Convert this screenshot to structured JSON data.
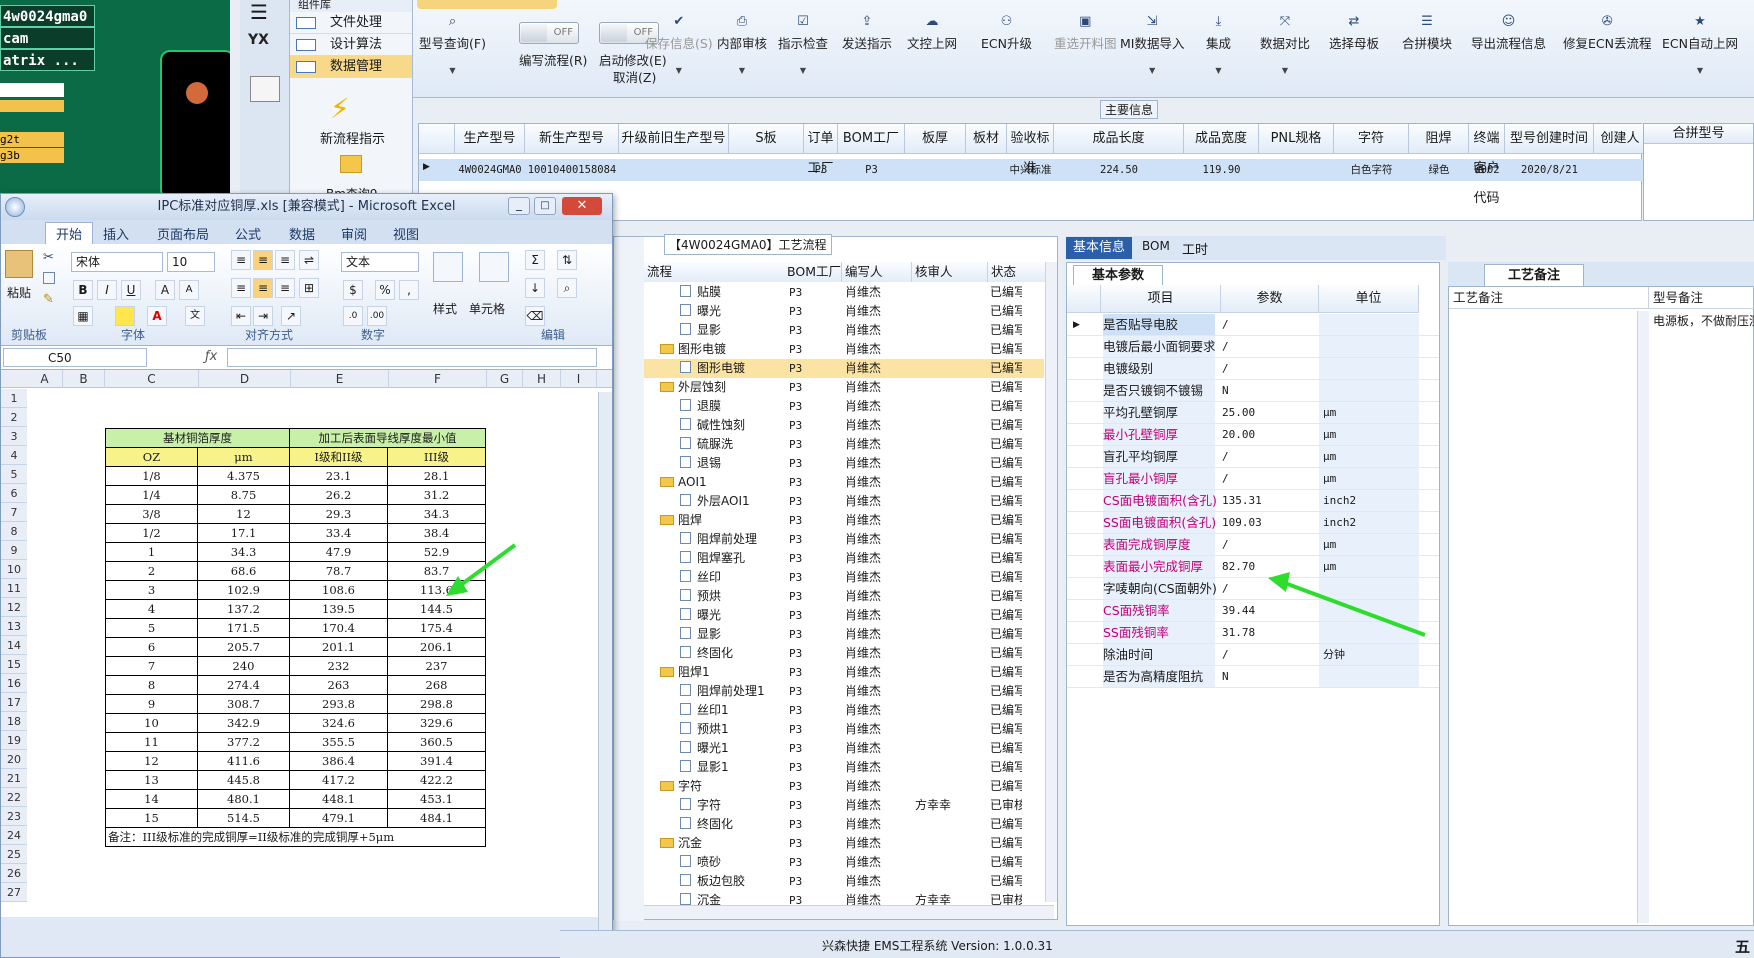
{
  "top_left": {
    "rows": [
      "4w0024gma0",
      "cam",
      "atrix ..."
    ],
    "yellow": [
      "g2t",
      "g3b"
    ]
  },
  "side_strip": {
    "logo": "YX"
  },
  "groups": {
    "title": "组件库",
    "items": [
      {
        "label": "文件处理",
        "selected": false
      },
      {
        "label": "设计算法",
        "selected": false
      },
      {
        "label": "数据管理",
        "selected": true
      }
    ],
    "new_flow": "新流程指示",
    "cut_label": "Bm查询9"
  },
  "toolbar": {
    "buttons": [
      {
        "label": "型号查询(F)",
        "icon": "search-icon",
        "disabled": false,
        "dropdown": true
      },
      {
        "label": "编写流程(R)",
        "icon": "toggle",
        "disabled": false,
        "dropdown": false
      },
      {
        "label": "启动修改(E)",
        "sub": "取消(Z)",
        "icon": "toggle",
        "disabled": false,
        "dropdown": false
      },
      {
        "label": "保存信息(S)",
        "icon": "check-icon",
        "disabled": true,
        "dropdown": true
      },
      {
        "label": "内部审核",
        "icon": "printer-icon",
        "disabled": false,
        "dropdown": true
      },
      {
        "label": "指示检查",
        "icon": "checkbox-icon",
        "disabled": false,
        "dropdown": true
      },
      {
        "label": "发送指示",
        "icon": "upload-icon",
        "disabled": false,
        "dropdown": false
      },
      {
        "label": "文控上网",
        "icon": "cloud-upload-icon",
        "disabled": false,
        "dropdown": false
      },
      {
        "label": "ECN升级",
        "icon": "people-icon",
        "disabled": false,
        "dropdown": false
      },
      {
        "label": "重选开料图",
        "icon": "image-icon",
        "disabled": true,
        "dropdown": false
      },
      {
        "label": "MI数据导入",
        "icon": "import-icon",
        "disabled": false,
        "dropdown": true
      },
      {
        "label": "集成",
        "icon": "download-icon",
        "disabled": false,
        "dropdown": true
      },
      {
        "label": "数据对比",
        "icon": "compare-icon",
        "disabled": false,
        "dropdown": true
      },
      {
        "label": "选择母板",
        "icon": "shuffle-icon",
        "disabled": false,
        "dropdown": false
      },
      {
        "label": "合拼模块",
        "icon": "list-icon",
        "disabled": false,
        "dropdown": false
      },
      {
        "label": "导出流程信息",
        "icon": "smiley-icon",
        "disabled": false,
        "dropdown": false
      },
      {
        "label": "修复ECN丢流程",
        "icon": "wrench-icon",
        "disabled": false,
        "dropdown": false
      },
      {
        "label": "ECN自动上网",
        "icon": "star-icon",
        "disabled": false,
        "dropdown": true
      }
    ],
    "toggle_off": "OFF"
  },
  "main_info": {
    "title": "主要信息",
    "columns": [
      "生产型号",
      "新生产型号",
      "升级前旧生产型号",
      "S板",
      "订单工厂",
      "BOM工厂",
      "板厚",
      "板材",
      "验收标准",
      "成品长度",
      "成品宽度",
      "PNL规格",
      "字符",
      "阻焊",
      "终端客户代码",
      "型号创建时间",
      "创建人"
    ],
    "row": [
      "4W0024GMA0",
      "10010400158084",
      "",
      "",
      "P3",
      "P3",
      "",
      "",
      "中兴标准",
      "224.50",
      "119.90",
      "",
      "白色字符",
      "绿色",
      "W002",
      "2020/8/21",
      ""
    ],
    "pin_header": "合拼型号"
  },
  "excel": {
    "title": "IPC标准对应铜厚.xls [兼容模式] - Microsoft Excel",
    "tabs": [
      "开始",
      "插入",
      "页面布局",
      "公式",
      "数据",
      "审阅",
      "视图"
    ],
    "font_name": "宋体",
    "font_size": "10",
    "number_format": "文本",
    "groups": [
      "剪贴板",
      "字体",
      "对齐方式",
      "数字",
      "样式",
      "单元格",
      "编辑"
    ],
    "paste": "粘贴",
    "style_label": "样式",
    "cells_label": "单元格",
    "name_box": "C50",
    "columns": [
      "A",
      "B",
      "C",
      "D",
      "E",
      "F",
      "G",
      "H",
      "I"
    ],
    "rows": [
      "1",
      "2",
      "3",
      "4",
      "5",
      "6",
      "7",
      "8",
      "9",
      "10",
      "11",
      "12",
      "13",
      "14",
      "15",
      "16",
      "17",
      "18",
      "19",
      "20",
      "21",
      "22",
      "23",
      "24",
      "25",
      "26",
      "27"
    ],
    "table_head1": [
      "基材铜箔厚度",
      "加工后表面导线厚度最小值"
    ],
    "table_head2": [
      "OZ",
      "μm",
      "I级和II级",
      "III级"
    ],
    "table_rows": [
      [
        "1/8",
        "4.375",
        "23.1",
        "28.1"
      ],
      [
        "1/4",
        "8.75",
        "26.2",
        "31.2"
      ],
      [
        "3/8",
        "12",
        "29.3",
        "34.3"
      ],
      [
        "1/2",
        "17.1",
        "33.4",
        "38.4"
      ],
      [
        "1",
        "34.3",
        "47.9",
        "52.9"
      ],
      [
        "2",
        "68.6",
        "78.7",
        "83.7"
      ],
      [
        "3",
        "102.9",
        "108.6",
        "113.6"
      ],
      [
        "4",
        "137.2",
        "139.5",
        "144.5"
      ],
      [
        "5",
        "171.5",
        "170.4",
        "175.4"
      ],
      [
        "6",
        "205.7",
        "201.1",
        "206.1"
      ],
      [
        "7",
        "240",
        "232",
        "237"
      ],
      [
        "8",
        "274.4",
        "263",
        "268"
      ],
      [
        "9",
        "308.7",
        "293.8",
        "298.8"
      ],
      [
        "10",
        "342.9",
        "324.6",
        "329.6"
      ],
      [
        "11",
        "377.2",
        "355.5",
        "360.5"
      ],
      [
        "12",
        "411.6",
        "386.4",
        "391.4"
      ],
      [
        "13",
        "445.8",
        "417.2",
        "422.2"
      ],
      [
        "14",
        "480.1",
        "448.1",
        "453.1"
      ],
      [
        "15",
        "514.5",
        "479.1",
        "484.1"
      ]
    ],
    "note": "备注：III级标准的完成铜厚=II级标准的完成铜厚+5μm"
  },
  "flow": {
    "title": "【4W0024GMA0】工艺流程",
    "columns": [
      "流程",
      "BOM工厂",
      "编写人",
      "核审人",
      "状态"
    ],
    "rows": [
      {
        "name": "贴膜",
        "level": 2,
        "folder": false,
        "bom": "P3",
        "author": "肖维杰",
        "reviewer": "",
        "status": "已编写"
      },
      {
        "name": "曝光",
        "level": 2,
        "folder": false,
        "bom": "P3",
        "author": "肖维杰",
        "reviewer": "",
        "status": "已编写"
      },
      {
        "name": "显影",
        "level": 2,
        "folder": false,
        "bom": "P3",
        "author": "肖维杰",
        "reviewer": "",
        "status": "已编写"
      },
      {
        "name": "图形电镀",
        "level": 1,
        "folder": true,
        "bom": "P3",
        "author": "肖维杰",
        "reviewer": "",
        "status": "已编写"
      },
      {
        "name": "图形电镀",
        "level": 2,
        "folder": false,
        "bom": "P3",
        "author": "肖维杰",
        "reviewer": "",
        "status": "已编写",
        "selected": true
      },
      {
        "name": "外层蚀刻",
        "level": 1,
        "folder": true,
        "bom": "P3",
        "author": "肖维杰",
        "reviewer": "",
        "status": "已编写"
      },
      {
        "name": "退膜",
        "level": 2,
        "folder": false,
        "bom": "P3",
        "author": "肖维杰",
        "reviewer": "",
        "status": "已编写"
      },
      {
        "name": "碱性蚀刻",
        "level": 2,
        "folder": false,
        "bom": "P3",
        "author": "肖维杰",
        "reviewer": "",
        "status": "已编写"
      },
      {
        "name": "硫脲洗",
        "level": 2,
        "folder": false,
        "bom": "P3",
        "author": "肖维杰",
        "reviewer": "",
        "status": "已编写"
      },
      {
        "name": "退锡",
        "level": 2,
        "folder": false,
        "bom": "P3",
        "author": "肖维杰",
        "reviewer": "",
        "status": "已编写"
      },
      {
        "name": "AOI1",
        "level": 1,
        "folder": true,
        "bom": "P3",
        "author": "肖维杰",
        "reviewer": "",
        "status": "已编写"
      },
      {
        "name": "外层AOI1",
        "level": 2,
        "folder": false,
        "bom": "P3",
        "author": "肖维杰",
        "reviewer": "",
        "status": "已编写"
      },
      {
        "name": "阻焊",
        "level": 1,
        "folder": true,
        "bom": "P3",
        "author": "肖维杰",
        "reviewer": "",
        "status": "已编写"
      },
      {
        "name": "阻焊前处理",
        "level": 2,
        "folder": false,
        "bom": "P3",
        "author": "肖维杰",
        "reviewer": "",
        "status": "已编写"
      },
      {
        "name": "阻焊塞孔",
        "level": 2,
        "folder": false,
        "bom": "P3",
        "author": "肖维杰",
        "reviewer": "",
        "status": "已编写"
      },
      {
        "name": "丝印",
        "level": 2,
        "folder": false,
        "bom": "P3",
        "author": "肖维杰",
        "reviewer": "",
        "status": "已编写"
      },
      {
        "name": "预烘",
        "level": 2,
        "folder": false,
        "bom": "P3",
        "author": "肖维杰",
        "reviewer": "",
        "status": "已编写"
      },
      {
        "name": "曝光",
        "level": 2,
        "folder": false,
        "bom": "P3",
        "author": "肖维杰",
        "reviewer": "",
        "status": "已编写"
      },
      {
        "name": "显影",
        "level": 2,
        "folder": false,
        "bom": "P3",
        "author": "肖维杰",
        "reviewer": "",
        "status": "已编写"
      },
      {
        "name": "终固化",
        "level": 2,
        "folder": false,
        "bom": "P3",
        "author": "肖维杰",
        "reviewer": "",
        "status": "已编写"
      },
      {
        "name": "阻焊1",
        "level": 1,
        "folder": true,
        "bom": "P3",
        "author": "肖维杰",
        "reviewer": "",
        "status": "已编写"
      },
      {
        "name": "阻焊前处理1",
        "level": 2,
        "folder": false,
        "bom": "P3",
        "author": "肖维杰",
        "reviewer": "",
        "status": "已编写"
      },
      {
        "name": "丝印1",
        "level": 2,
        "folder": false,
        "bom": "P3",
        "author": "肖维杰",
        "reviewer": "",
        "status": "已编写"
      },
      {
        "name": "预烘1",
        "level": 2,
        "folder": false,
        "bom": "P3",
        "author": "肖维杰",
        "reviewer": "",
        "status": "已编写"
      },
      {
        "name": "曝光1",
        "level": 2,
        "folder": false,
        "bom": "P3",
        "author": "肖维杰",
        "reviewer": "",
        "status": "已编写"
      },
      {
        "name": "显影1",
        "level": 2,
        "folder": false,
        "bom": "P3",
        "author": "肖维杰",
        "reviewer": "",
        "status": "已编写"
      },
      {
        "name": "字符",
        "level": 1,
        "folder": true,
        "bom": "P3",
        "author": "肖维杰",
        "reviewer": "",
        "status": "已编写"
      },
      {
        "name": "字符",
        "level": 2,
        "folder": false,
        "bom": "P3",
        "author": "肖维杰",
        "reviewer": "方幸幸",
        "status": "已审核"
      },
      {
        "name": "终固化",
        "level": 2,
        "folder": false,
        "bom": "P3",
        "author": "肖维杰",
        "reviewer": "",
        "status": "已编写"
      },
      {
        "name": "沉金",
        "level": 1,
        "folder": true,
        "bom": "P3",
        "author": "肖维杰",
        "reviewer": "",
        "status": "已编写"
      },
      {
        "name": "喷砂",
        "level": 2,
        "folder": false,
        "bom": "P3",
        "author": "肖维杰",
        "reviewer": "",
        "status": "已编写"
      },
      {
        "name": "板边包胶",
        "level": 2,
        "folder": false,
        "bom": "P3",
        "author": "肖维杰",
        "reviewer": "",
        "status": "已编写"
      },
      {
        "name": "沉金",
        "level": 2,
        "folder": false,
        "bom": "P3",
        "author": "肖维杰",
        "reviewer": "方幸幸",
        "status": "已审核"
      }
    ]
  },
  "info": {
    "tabs": [
      "基本信息",
      "BOM",
      "工时"
    ],
    "subtab": "基本参数",
    "columns": [
      "项目",
      "参数",
      "单位"
    ],
    "rows": [
      {
        "k": "是否贴导电胶",
        "v": "/",
        "u": "",
        "red": false
      },
      {
        "k": "电镀后最小面铜要求",
        "v": "/",
        "u": "",
        "red": false
      },
      {
        "k": "电镀级别",
        "v": "/",
        "u": "",
        "red": false
      },
      {
        "k": "是否只镀铜不镀锡",
        "v": "N",
        "u": "",
        "red": false
      },
      {
        "k": "平均孔壁铜厚",
        "v": "25.00",
        "u": "μm",
        "red": false
      },
      {
        "k": "最小孔壁铜厚",
        "v": "20.00",
        "u": "μm",
        "red": true
      },
      {
        "k": "盲孔平均铜厚",
        "v": "/",
        "u": "μm",
        "red": false
      },
      {
        "k": "盲孔最小铜厚",
        "v": "/",
        "u": "μm",
        "red": true
      },
      {
        "k": "CS面电镀面积(含孔)",
        "v": "135.31",
        "u": "inch2",
        "red": true
      },
      {
        "k": "SS面电镀面积(含孔)",
        "v": "109.03",
        "u": "inch2",
        "red": true
      },
      {
        "k": "表面完成铜厚度",
        "v": "/",
        "u": "μm",
        "red": true
      },
      {
        "k": "表面最小完成铜厚",
        "v": "82.70",
        "u": "μm",
        "red": true
      },
      {
        "k": "字唛朝向(CS面朝外)",
        "v": "/",
        "u": "",
        "red": false
      },
      {
        "k": "CS面残铜率",
        "v": "39.44",
        "u": "",
        "red": true
      },
      {
        "k": "SS面残铜率",
        "v": "31.78",
        "u": "",
        "red": true
      },
      {
        "k": "除油时间",
        "v": "/",
        "u": "分钟",
        "red": false
      },
      {
        "k": "是否为高精度阻抗",
        "v": "N",
        "u": "",
        "red": false
      }
    ]
  },
  "notes": {
    "tab": "工艺备注",
    "col1": "工艺备注",
    "col2": "型号备注",
    "model_note": "电源板，不做耐压测"
  },
  "status": {
    "text": "兴森快捷 EMS工程系统 Version: 1.0.0.31",
    "right": "五"
  },
  "colors": {
    "accent": "#2b5fa8",
    "arrow": "#2ddc2d",
    "red_label": "#c0007a"
  }
}
